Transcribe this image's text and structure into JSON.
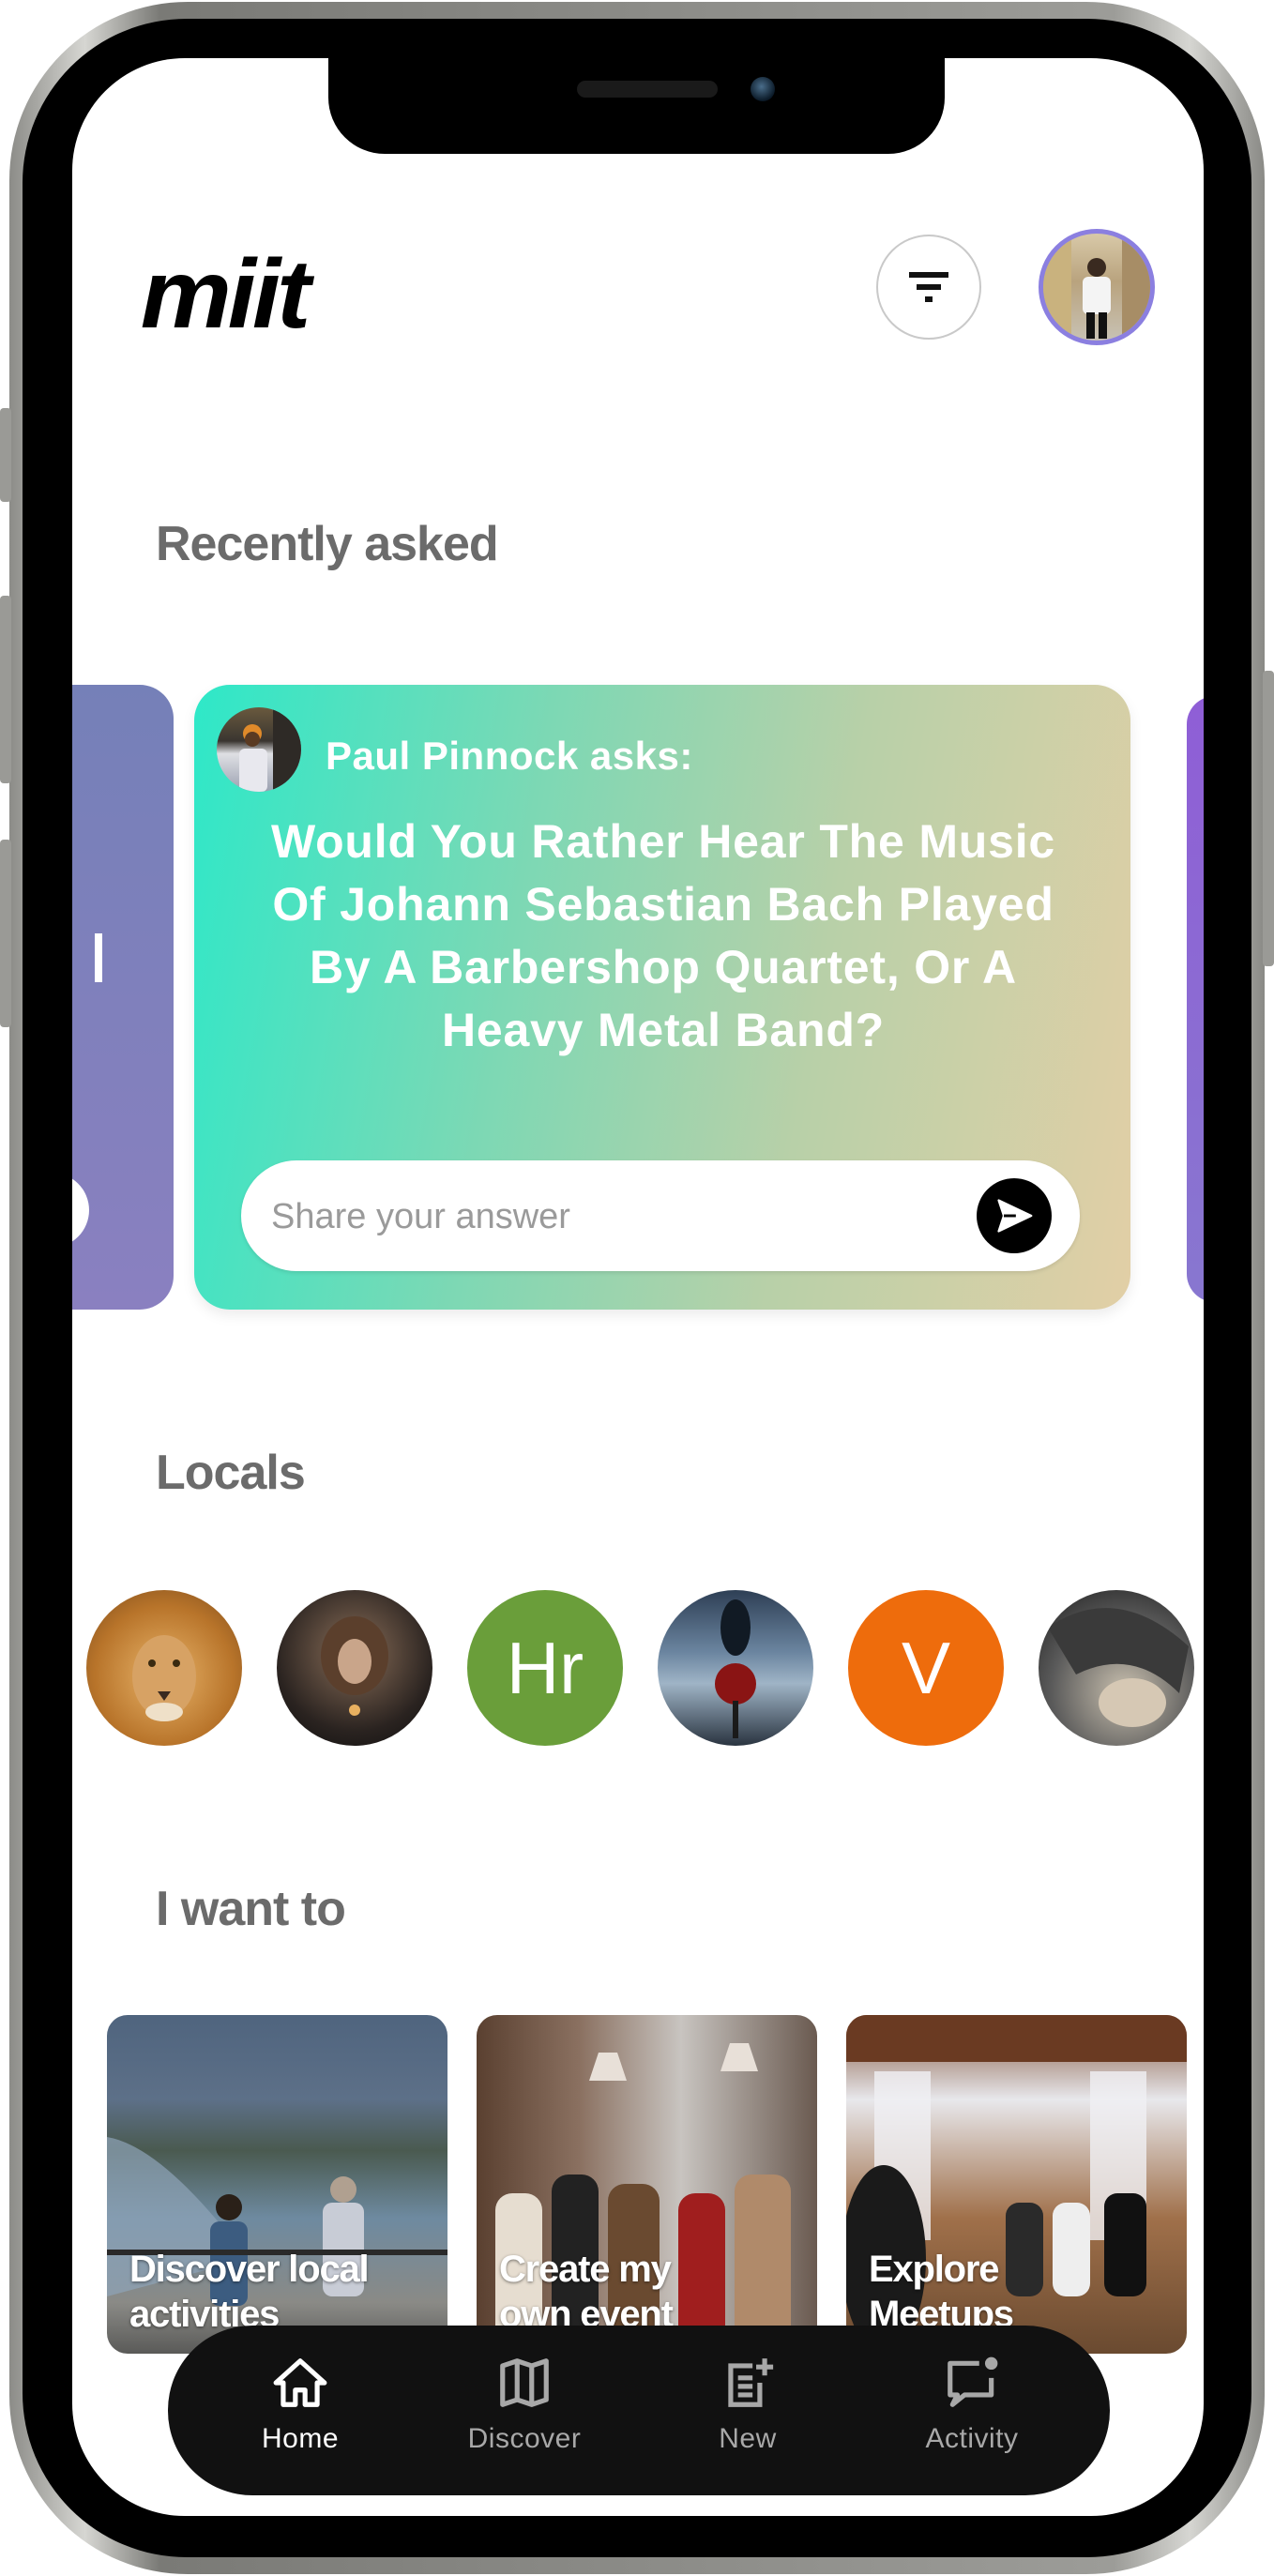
{
  "app": {
    "name": "miit"
  },
  "header": {
    "filter_icon": "filter-lines-icon",
    "profile_avatar": "user-photo"
  },
  "recently_asked": {
    "title": "Recently asked",
    "card": {
      "asker": "Paul Pinnock asks:",
      "question": "Would You Rather Hear The Music Of Johann Sebastian Bach Played By A Barbershop Quartet, Or A Heavy Metal Band?",
      "answer_placeholder": "Share your answer",
      "send_icon": "send-arrow-icon"
    },
    "colors": {
      "card_gradient_start": "#2ee8c8",
      "card_gradient_end": "#e2cfa6",
      "left_card": "#7a80bc",
      "right_card": "#8f5ed6"
    }
  },
  "locals": {
    "title": "Locals",
    "people": [
      {
        "type": "photo",
        "desc": "lion"
      },
      {
        "type": "photo",
        "desc": "portrait"
      },
      {
        "type": "initials",
        "initials": "Hr",
        "color": "#6a9e3a"
      },
      {
        "type": "photo",
        "desc": "rose"
      },
      {
        "type": "initials",
        "initials": "V",
        "color": "#ee6c0c"
      },
      {
        "type": "photo",
        "desc": "hair"
      }
    ]
  },
  "i_want_to": {
    "title": "I want to",
    "tiles": [
      {
        "label_line1": "Discover local",
        "label_line2": "activities"
      },
      {
        "label_line1": "Create my",
        "label_line2": "own event"
      },
      {
        "label_line1": "Explore",
        "label_line2": "Meetups"
      }
    ]
  },
  "bottom_nav": {
    "items": [
      {
        "label": "Home",
        "icon": "home-icon",
        "active": true
      },
      {
        "label": "Discover",
        "icon": "map-icon",
        "active": false
      },
      {
        "label": "New",
        "icon": "new-post-icon",
        "active": false
      },
      {
        "label": "Activity",
        "icon": "activity-chat-icon",
        "active": false
      }
    ]
  }
}
